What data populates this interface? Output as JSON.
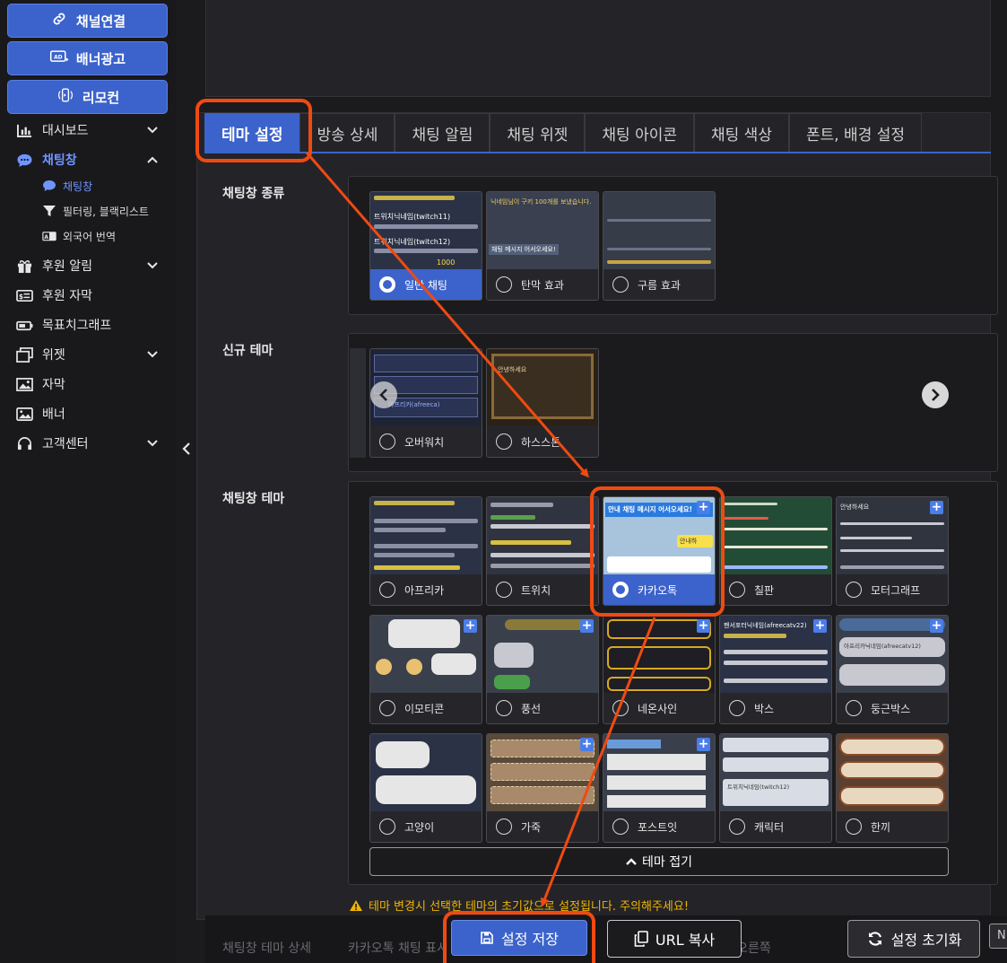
{
  "sidebar": {
    "buttons": [
      {
        "label": "채널연결",
        "icon": "link-icon"
      },
      {
        "label": "배너광고",
        "icon": "ad-icon"
      },
      {
        "label": "리모컨",
        "icon": "remote-icon"
      }
    ],
    "items": [
      {
        "label": "대시보드",
        "icon": "chart-bar-icon",
        "expandable": true
      },
      {
        "label": "채팅창",
        "icon": "chat-bubble-icon",
        "expandable": true,
        "active": true
      },
      {
        "label": "후원 알림",
        "icon": "gift-icon",
        "expandable": true
      },
      {
        "label": "후원 자막",
        "icon": "money-icon"
      },
      {
        "label": "목표치그래프",
        "icon": "battery-icon"
      },
      {
        "label": "위젯",
        "icon": "window-icon",
        "expandable": true
      },
      {
        "label": "자막",
        "icon": "image-caption-icon"
      },
      {
        "label": "배너",
        "icon": "banner-icon"
      },
      {
        "label": "고객센터",
        "icon": "headset-icon",
        "expandable": true
      }
    ],
    "subitems": [
      {
        "label": "채팅창",
        "icon": "chat-bubble-icon",
        "active": true
      },
      {
        "label": "필터링, 블랙리스트",
        "icon": "filter-icon"
      },
      {
        "label": "외국어 번역",
        "icon": "translate-icon"
      }
    ]
  },
  "tabs": [
    "테마 설정",
    "방송 상세",
    "채팅 알림",
    "채팅 위젯",
    "채팅 아이콘",
    "채팅 색상",
    "폰트, 배경 설정"
  ],
  "sections": {
    "chat_type": {
      "label": "채팅창 종류",
      "options": [
        {
          "label": "일반 채팅",
          "selected": true
        },
        {
          "label": "탄막 효과",
          "selected": false
        },
        {
          "label": "구름 효과",
          "selected": false
        }
      ]
    },
    "new_theme": {
      "label": "신규 테마",
      "options": [
        {
          "label": "오버워치"
        },
        {
          "label": "하스스톤"
        }
      ]
    },
    "chat_theme": {
      "label": "채팅창 테마",
      "options": [
        {
          "label": "아프리카",
          "selected": false
        },
        {
          "label": "트위치",
          "selected": false
        },
        {
          "label": "카카오톡",
          "selected": true
        },
        {
          "label": "칠판",
          "selected": false
        },
        {
          "label": "모터그래프",
          "selected": false
        },
        {
          "label": "이모티콘",
          "selected": false
        },
        {
          "label": "풍선",
          "selected": false
        },
        {
          "label": "네온사인",
          "selected": false
        },
        {
          "label": "박스",
          "selected": false
        },
        {
          "label": "둥근박스",
          "selected": false
        },
        {
          "label": "고양이",
          "selected": false
        },
        {
          "label": "가죽",
          "selected": false
        },
        {
          "label": "포스트잇",
          "selected": false
        },
        {
          "label": "캐릭터",
          "selected": false
        },
        {
          "label": "한끼",
          "selected": false
        }
      ],
      "fold_label": "테마 접기"
    }
  },
  "previews": {
    "kakao_banner": "안내 채팅 메시지 어서오세요!",
    "kakao_notice": "안내하",
    "general_line": "트위치닉네임(twitch11)",
    "general_line2": "트위치닉네임(twitch12)",
    "general_coin": "1000",
    "tanmak_text": "채팅 메시지 어서오세요!",
    "tanmak_top": "닉네임님이 구키 100개를 보냈습니다.",
    "hearthstone_text": "안녕하세요",
    "overwatch_text": "아프리카(afreeca)",
    "box_nick": "팬서포터닉네임(afreecatv22)",
    "round_nick": "아프리카닉네임(afreecatv12)",
    "motor_text": "안녕하세요",
    "character_text": "트위치닉네임(twitch12)"
  },
  "warning": "테마 변경시 선택한 테마의 초기값으로 설정됩니다. 주의해주세요!",
  "bottom": {
    "save_label": "설정 저장",
    "url_label": "URL 복사",
    "reset_label": "설정 초기화",
    "edge_label": "N",
    "faded_left": "채팅창 테마 상세",
    "faded_mid": "카카오톡 채팅 표시",
    "faded_right": "BJ만 오른쪽"
  },
  "colors": {
    "accent": "#3c63cc",
    "highlight": "#f04a12",
    "warning": "#f0b400",
    "background": "#1b1b1e"
  }
}
